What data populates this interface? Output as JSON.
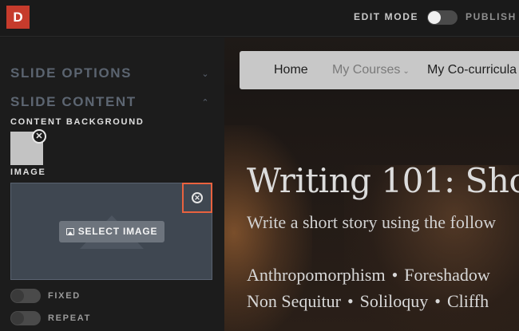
{
  "topbar": {
    "logo_letter": "D",
    "edit_mode_label": "EDIT MODE",
    "edit_mode_on": false,
    "publish_label": "PUBLISH"
  },
  "sidebar": {
    "slide_options": "SLIDE OPTIONS",
    "slide_content": "SLIDE CONTENT",
    "content_background": "CONTENT BACKGROUND",
    "image_label": "IMAGE",
    "select_image": "SELECT IMAGE",
    "fixed_label": "FIXED",
    "repeat_label": "REPEAT",
    "fixed_on": false,
    "repeat_on": false
  },
  "preview": {
    "nav": {
      "home": "Home",
      "my_courses": "My Courses",
      "co_curricular": "My Co-curricula"
    },
    "title": "Writing 101: Sho",
    "subtitle": "Write a short story using the follow",
    "terms_line1": [
      "Anthropomorphism",
      "Foreshadow"
    ],
    "terms_line2": [
      "Non Sequitur",
      "Soliloquy",
      "Cliffh"
    ],
    "separator": "•"
  },
  "colors": {
    "logo_bg": "#c63b2c",
    "highlight_border": "#e9623f",
    "sidebar_heading": "#5b6470"
  }
}
